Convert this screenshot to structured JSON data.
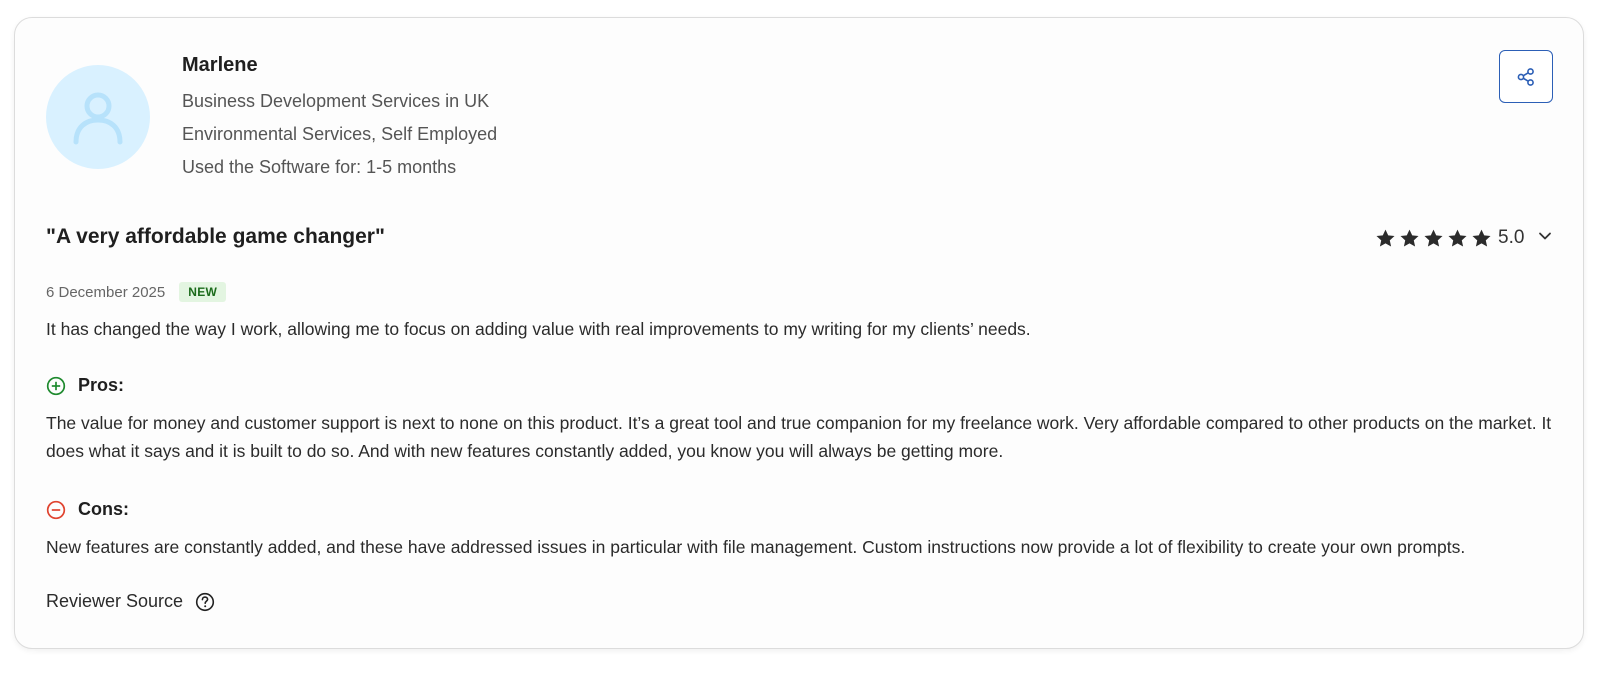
{
  "reviewer": {
    "name": "Marlene",
    "role": "Business Development Services in UK",
    "industry": "Environmental Services, Self Employed",
    "usage": "Used the Software for: 1-5 months"
  },
  "review": {
    "title": "\"A very affordable game changer\"",
    "date": "6 December 2025",
    "badge": "NEW",
    "rating": {
      "value": 5.0,
      "max": 5,
      "label": "5.0"
    },
    "summary": "It has changed the way I work, allowing me to focus on adding value with real improvements to my writing for my clients’ needs.",
    "pros": {
      "label": "Pros:",
      "text": "The value for money and customer support is next to none on this product. It’s a great tool and true companion for my freelance work. Very affordable compared to other products on the market. It does what it says and it is built to do so. And with new features constantly added, you know you will always be getting more."
    },
    "cons": {
      "label": "Cons:",
      "text": "New features are constantly added, and these have addressed issues in particular with file management. Custom instructions now provide a lot of flexibility to create your own prompts."
    },
    "source_label": "Reviewer Source"
  },
  "icons": {
    "avatar": "person-icon",
    "share": "share-icon",
    "star": "star-icon",
    "expand": "chevron-down-icon",
    "pros": "plus-circle-icon",
    "cons": "minus-circle-icon",
    "help": "question-circle-icon"
  },
  "colors": {
    "avatar_bg": "#d9f1ff",
    "avatar_fg": "#b7e2fb",
    "share_border": "#2c5fb6",
    "pros_green": "#1e8a2e",
    "cons_red": "#e0432f",
    "badge_bg": "#e3f5e1",
    "badge_fg": "#1b6b1b"
  }
}
